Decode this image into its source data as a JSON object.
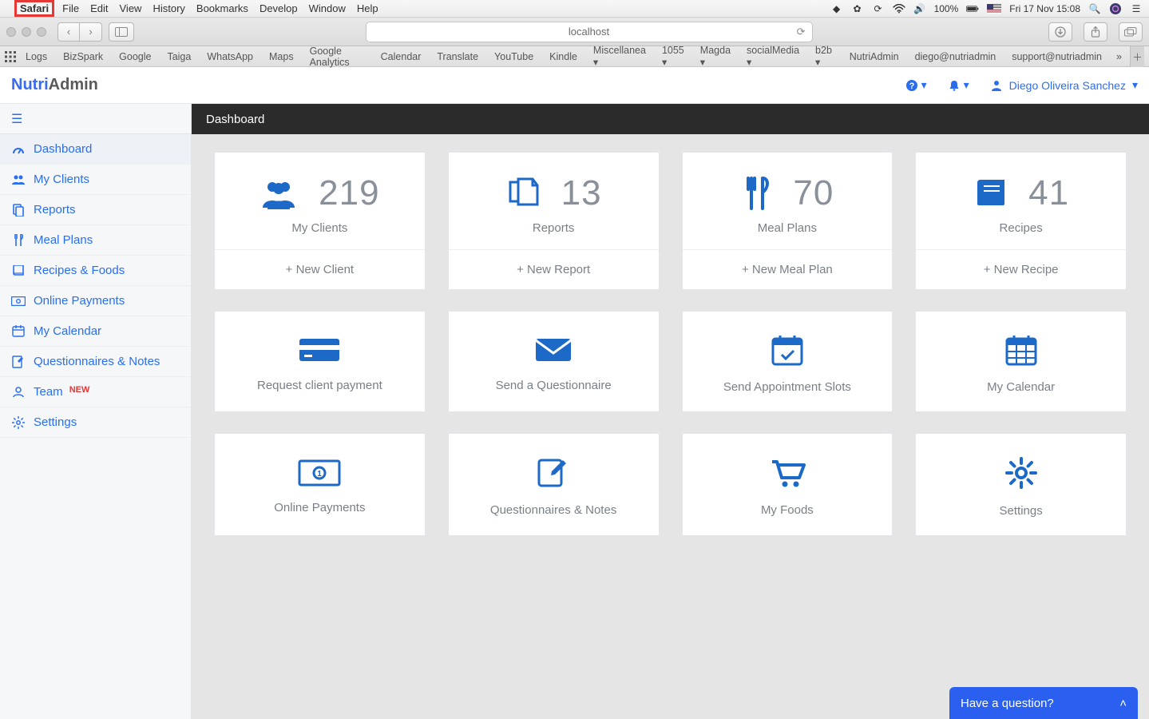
{
  "mac_menu": {
    "items": [
      "Safari",
      "File",
      "Edit",
      "View",
      "History",
      "Bookmarks",
      "Develop",
      "Window",
      "Help"
    ],
    "battery": "100%",
    "datetime": "Fri 17 Nov  15:08"
  },
  "browser": {
    "url": "localhost",
    "favorites": [
      "Logs",
      "BizSpark",
      "Google",
      "Taiga",
      "WhatsApp",
      "Maps",
      "Google Analytics",
      "Calendar",
      "Translate",
      "YouTube",
      "Kindle",
      "Miscellanea ▾",
      "1055 ▾",
      "Magda ▾",
      "socialMedia ▾",
      "b2b ▾",
      "NutriAdmin",
      "diego@nutriadmin",
      "support@nutriadmin"
    ]
  },
  "app": {
    "brand_left": "Nutri",
    "brand_right": "Admin",
    "username": "Diego Oliveira Sanchez"
  },
  "sidebar": {
    "items": [
      {
        "label": "Dashboard"
      },
      {
        "label": "My Clients"
      },
      {
        "label": "Reports"
      },
      {
        "label": "Meal Plans"
      },
      {
        "label": "Recipes & Foods"
      },
      {
        "label": "Online Payments"
      },
      {
        "label": "My Calendar"
      },
      {
        "label": "Questionnaires & Notes"
      },
      {
        "label": "Team",
        "badge": "NEW"
      },
      {
        "label": "Settings"
      }
    ]
  },
  "page": {
    "title": "Dashboard"
  },
  "stats": [
    {
      "count": "219",
      "label": "My Clients",
      "action": "+ New Client"
    },
    {
      "count": "13",
      "label": "Reports",
      "action": "+ New Report"
    },
    {
      "count": "70",
      "label": "Meal Plans",
      "action": "+ New Meal Plan"
    },
    {
      "count": "41",
      "label": "Recipes",
      "action": "+ New Recipe"
    }
  ],
  "tiles_row1": [
    {
      "label": "Request client payment"
    },
    {
      "label": "Send a Questionnaire"
    },
    {
      "label": "Send Appointment Slots"
    },
    {
      "label": "My Calendar"
    }
  ],
  "tiles_row2": [
    {
      "label": "Online Payments"
    },
    {
      "label": "Questionnaires & Notes"
    },
    {
      "label": "My Foods"
    },
    {
      "label": "Settings"
    }
  ],
  "chat": {
    "text": "Have a question?"
  }
}
